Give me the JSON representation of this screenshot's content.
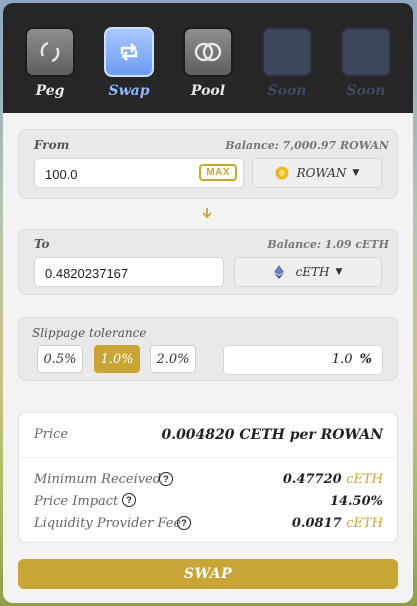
{
  "nav": {
    "items": [
      {
        "label": "Peg"
      },
      {
        "label": "Swap"
      },
      {
        "label": "Pool"
      },
      {
        "label": "Soon"
      },
      {
        "label": "Soon"
      }
    ]
  },
  "from": {
    "label": "From",
    "balance": "Balance: 7,000.97 ROWAN",
    "amount": "100.0",
    "max_label": "MAX",
    "token": "ROWAN"
  },
  "to": {
    "label": "To",
    "balance": "Balance: 1.09 cETH",
    "amount": "0.4820237167",
    "token": "cETH"
  },
  "slippage": {
    "label": "Slippage tolerance",
    "options": [
      "0.5%",
      "1.0%",
      "2.0%"
    ],
    "selected": "1.0%",
    "custom_value": "1.0",
    "custom_unit": "%"
  },
  "price": {
    "label": "Price",
    "value": "0.004820 CETH per ROWAN"
  },
  "details": {
    "min_received_label": "Minimum Received",
    "min_received_value": "0.47720",
    "min_received_unit": "cETH",
    "price_impact_label": "Price Impact",
    "price_impact_value": "14.50%",
    "lp_fee_label": "Liquidity Provider Fee",
    "lp_fee_value": "0.0817",
    "lp_fee_unit": "cETH"
  },
  "swap_button": "SWAP",
  "colors": {
    "accent_gold": "#c9a535",
    "active_blue": "#8fb6ff",
    "nav_bg": "#262626"
  }
}
